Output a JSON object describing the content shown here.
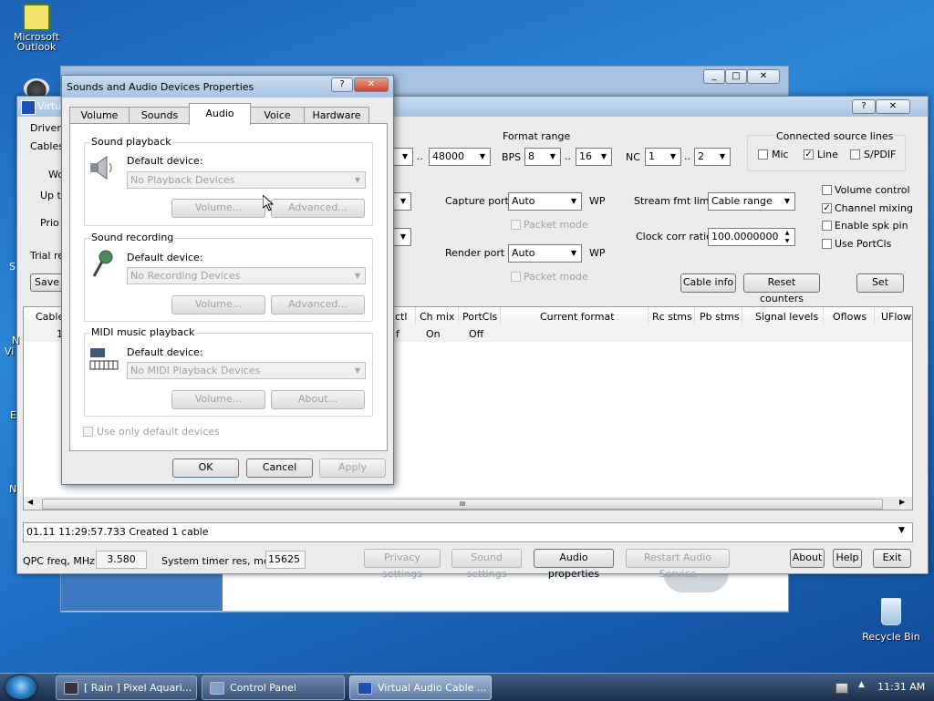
{
  "desktop": {
    "outlook_label_1": "Microsoft",
    "outlook_label_2": "Outlook",
    "recycle_label": "Recycle Bin"
  },
  "taskbar": {
    "items": [
      "[ Rain ] Pixel Aquari...",
      "Control Panel",
      "Virtual Audio Cable ..."
    ],
    "clock": "11:31 AM"
  },
  "vac": {
    "title_visible": "Virtu",
    "left_labels": [
      "Driver",
      "Cables",
      "Wo",
      "Up to",
      "Prio",
      "Trial re",
      "Save l"
    ],
    "format_range": "Format range",
    "sr_value": "48000",
    "bps_label": "BPS",
    "bps_min": "8",
    "bps_max": "16",
    "nc_label": "NC",
    "nc_min": "1",
    "nc_max": "2",
    "dots": "..",
    "connected_label": "Connected source lines",
    "mic": "Mic",
    "line": "Line",
    "spdif": "S/PDIF",
    "capture_port": "Capture port",
    "capture_value": "Auto",
    "render_port": "Render port",
    "render_value": "Auto",
    "wp": "WP",
    "packet_mode": "Packet mode",
    "stream_fmt": "Stream fmt limit",
    "stream_fmt_value": "Cable range",
    "clock_corr": "Clock corr ratio",
    "clock_corr_value": "100.0000000",
    "volume_control": "Volume control",
    "channel_mixing": "Channel mixing",
    "enable_spk": "Enable spk pin",
    "use_portcls": "Use PortCls",
    "cable_info": "Cable info",
    "reset_counters": "Reset counters",
    "set": "Set",
    "table_headers": [
      "Cable",
      "ctl",
      "Ch mix",
      "PortCls",
      "Current format",
      "Rc stms",
      "Pb stms",
      "Signal levels",
      "Oflows",
      "UFlows"
    ],
    "table_row": [
      "1",
      "f",
      "On",
      "Off"
    ],
    "log": "01.11   11:29:57.733   Created 1 cable",
    "qpc_label": "QPC freq, MHz",
    "qpc_value": "3.580",
    "timer_label": "System timer res, mcs",
    "timer_value": "15625",
    "privacy": "Privacy settings",
    "sound_settings": "Sound settings",
    "audio_props": "Audio properties",
    "restart": "Restart Audio Service",
    "about": "About",
    "help": "Help",
    "exit": "Exit",
    "scroll_grip": "III",
    "side_letters": [
      "S",
      "N",
      "Vi",
      "E",
      "N"
    ]
  },
  "dialog": {
    "title": "Sounds and Audio Devices Properties",
    "tabs": [
      "Volume",
      "Sounds",
      "Audio",
      "Voice",
      "Hardware"
    ],
    "playback_title": "Sound playback",
    "recording_title": "Sound recording",
    "midi_title": "MIDI music playback",
    "default_device": "Default device:",
    "no_playback": "No Playback Devices",
    "no_recording": "No Recording Devices",
    "no_midi": "No MIDI Playback Devices",
    "volume_btn": "Volume...",
    "advanced_btn": "Advanced...",
    "about_btn": "About...",
    "use_only_default": "Use only default devices",
    "ok": "OK",
    "cancel": "Cancel",
    "apply": "Apply"
  }
}
